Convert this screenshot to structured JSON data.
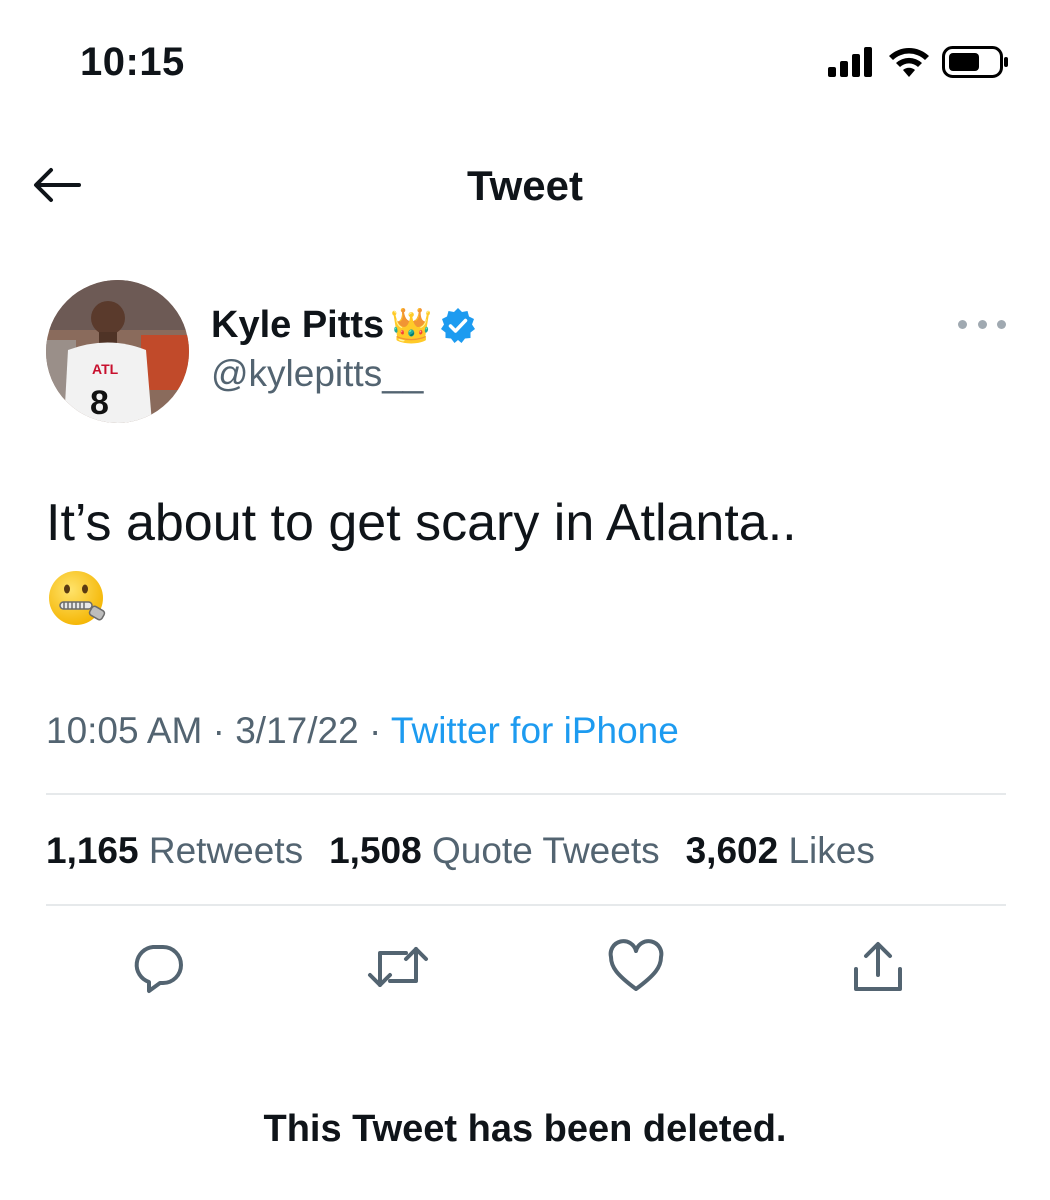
{
  "status_bar": {
    "time": "10:15",
    "icons": [
      "cellular-signal-icon",
      "wifi-icon",
      "battery-icon"
    ]
  },
  "nav": {
    "back_icon": "back-arrow-icon",
    "title": "Tweet"
  },
  "tweet": {
    "author": {
      "display_name": "Kyle Pitts",
      "name_emoji": "👑",
      "verified": true,
      "handle": "@kylepitts__"
    },
    "text": "It’s about to get scary in Atlanta..",
    "emoji": "🤐",
    "time": "10:05 AM",
    "date": "3/17/22",
    "separator": "·",
    "source": "Twitter for iPhone",
    "stats": {
      "retweets_count": "1,165",
      "retweets_label": "Retweets",
      "quotes_count": "1,508",
      "quotes_label": "Quote Tweets",
      "likes_count": "3,602",
      "likes_label": "Likes"
    },
    "actions": [
      "reply-icon",
      "retweet-icon",
      "like-icon",
      "share-icon"
    ]
  },
  "notice": "This Tweet has been deleted.",
  "colors": {
    "text": "#0f1419",
    "secondary": "#536471",
    "link": "#1d9bf0",
    "divider": "#e6e9eb"
  }
}
